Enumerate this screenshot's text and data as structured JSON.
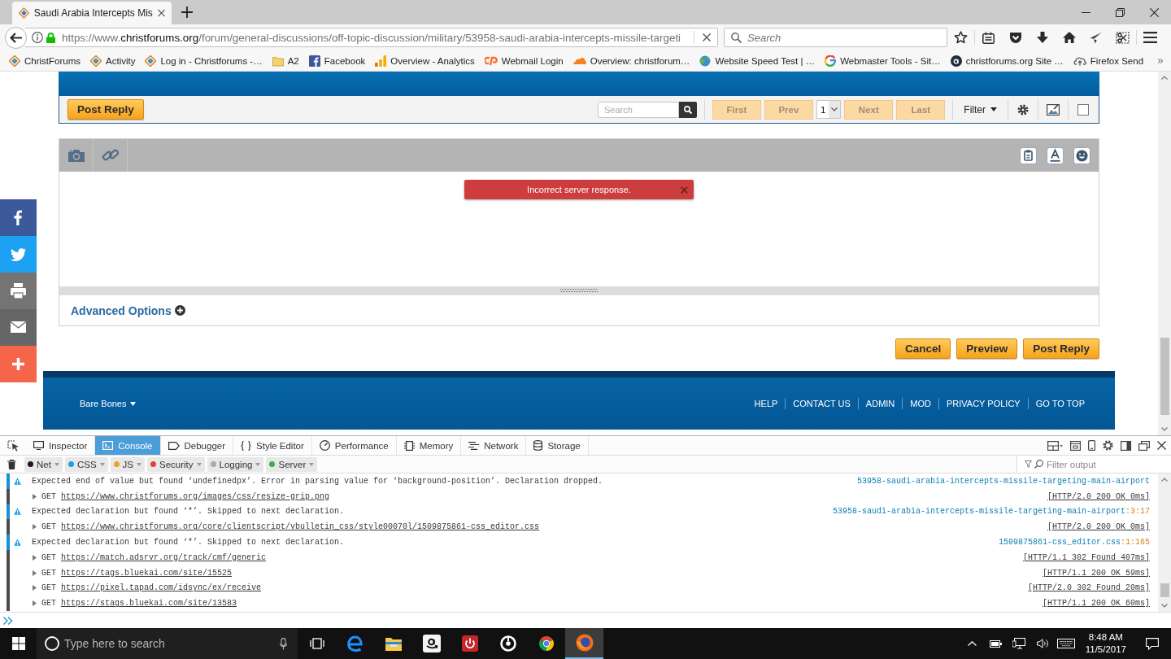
{
  "browser": {
    "tabs": [
      {
        "title": "Saudi Arabia Intercepts Mis",
        "selected": true
      }
    ],
    "address": {
      "scheme": "https://www.",
      "domain": "christforums.org",
      "path": "/forum/general-discussions/off-topic-discussion/military/53958-saudi-arabia-intercepts-missile-targeti",
      "secure": true
    },
    "search": {
      "placeholder": "Search"
    },
    "bookmarks": [
      {
        "label": "ChristForums",
        "kind": "site"
      },
      {
        "label": "Activity",
        "kind": "site"
      },
      {
        "label": "Log in - Christforums -…",
        "kind": "site"
      },
      {
        "label": "A2",
        "kind": "folder"
      },
      {
        "label": "Facebook",
        "kind": "facebook"
      },
      {
        "label": "Overview - Analytics",
        "kind": "analytics"
      },
      {
        "label": "Webmail Login",
        "kind": "cpanel"
      },
      {
        "label": "Overview: christforum…",
        "kind": "cloud"
      },
      {
        "label": "Website Speed Test | …",
        "kind": "globe"
      },
      {
        "label": "Webmaster Tools - Sit…",
        "kind": "google"
      },
      {
        "label": "christforums.org Site …",
        "kind": "alexa"
      },
      {
        "label": "Firefox Send",
        "kind": "send"
      }
    ]
  },
  "page": {
    "toolbar": {
      "reply_label": "Post Reply",
      "search_placeholder": "Search",
      "pager": [
        {
          "kind": "button",
          "label": "First",
          "disabled": true
        },
        {
          "kind": "button",
          "label": "Prev",
          "disabled": true
        },
        {
          "kind": "select",
          "value": "1"
        },
        {
          "kind": "button",
          "label": "Next",
          "disabled": true
        },
        {
          "kind": "button",
          "label": "Last",
          "disabled": true
        }
      ],
      "filter_label": "Filter",
      "select_all": {
        "checked": false
      }
    },
    "editor": {
      "error": "Incorrect server response."
    },
    "advanced_options": "Advanced Options",
    "actions": [
      "Cancel",
      "Preview",
      "Post Reply"
    ],
    "footer": {
      "style": "Bare Bones",
      "links": [
        "HELP",
        "CONTACT US",
        "ADMIN",
        "MOD",
        "PRIVACY POLICY",
        "GO TO TOP"
      ]
    }
  },
  "devtools": {
    "tabs": [
      {
        "label": "Inspector",
        "kind": "inspector",
        "selected": false
      },
      {
        "label": "Console",
        "kind": "console",
        "selected": true
      },
      {
        "label": "Debugger",
        "kind": "debugger",
        "selected": false
      },
      {
        "label": "Style Editor",
        "kind": "style",
        "selected": false
      },
      {
        "label": "Performance",
        "kind": "performance",
        "selected": false
      },
      {
        "label": "Memory",
        "kind": "memory",
        "selected": false
      },
      {
        "label": "Network",
        "kind": "network",
        "selected": false
      },
      {
        "label": "Storage",
        "kind": "storage",
        "selected": false
      }
    ],
    "filters": [
      {
        "label": "Net",
        "color": "#1a1a1a"
      },
      {
        "label": "CSS",
        "color": "#1fa0e6"
      },
      {
        "label": "JS",
        "color": "#f0a02c"
      },
      {
        "label": "Security",
        "color": "#e5413c"
      },
      {
        "label": "Logging",
        "color": "#a9a9a9"
      },
      {
        "label": "Server",
        "color": "#49a84a"
      }
    ],
    "filter_placeholder": "Filter output",
    "messages": [
      {
        "kind": "warning",
        "text": "Expected end of value but found ‘undefinedpx’. Error in parsing value for ‘background-position’. Declaration dropped.",
        "source": "53958-saudi-arabia-intercepts-missile-targeting-main-airport"
      },
      {
        "kind": "network",
        "method": "GET",
        "url": "https://www.christforums.org/images/css/resize-grip.png",
        "status": "[HTTP/2.0 200 OK 0ms]"
      },
      {
        "kind": "warning",
        "text": "Expected declaration but found ‘*’. Skipped to next declaration.",
        "source": "53958-saudi-arabia-intercepts-missile-targeting-main-airport",
        "location": ":3:17"
      },
      {
        "kind": "network",
        "method": "GET",
        "url": "https://www.christforums.org/core/clientscript/vbulletin_css/style00070l/1509875861-css_editor.css",
        "status": "[HTTP/2.0 200 OK 0ms]"
      },
      {
        "kind": "warning",
        "text": "Expected declaration but found ‘*’. Skipped to next declaration.",
        "source": "1509875861-css_editor.css",
        "location": ":1:165"
      },
      {
        "kind": "network",
        "method": "GET",
        "url": "https://match.adsrvr.org/track/cmf/generic",
        "status": "[HTTP/1.1 302 Found 407ms]"
      },
      {
        "kind": "network",
        "method": "GET",
        "url": "https://tags.bluekai.com/site/15525",
        "status": "[HTTP/1.1 200 OK 59ms]"
      },
      {
        "kind": "network",
        "method": "GET",
        "url": "https://pixel.tapad.com/idsync/ex/receive",
        "status": "[HTTP/2.0 302 Found 20ms]"
      },
      {
        "kind": "network",
        "method": "GET",
        "url": "https://stags.bluekai.com/site/13583",
        "status": "[HTTP/1.1 200 OK 60ms]"
      }
    ]
  },
  "taskbar": {
    "search_placeholder": "Type here to search",
    "apps": [
      {
        "kind": "edge",
        "selected": false
      },
      {
        "kind": "explorer",
        "selected": false
      },
      {
        "kind": "amazon",
        "selected": false
      },
      {
        "kind": "power",
        "selected": false
      },
      {
        "kind": "disc",
        "selected": false
      },
      {
        "kind": "chrome",
        "selected": false
      },
      {
        "kind": "firefox",
        "selected": true
      }
    ],
    "time": "8:48 AM",
    "date": "11/5/2017"
  }
}
